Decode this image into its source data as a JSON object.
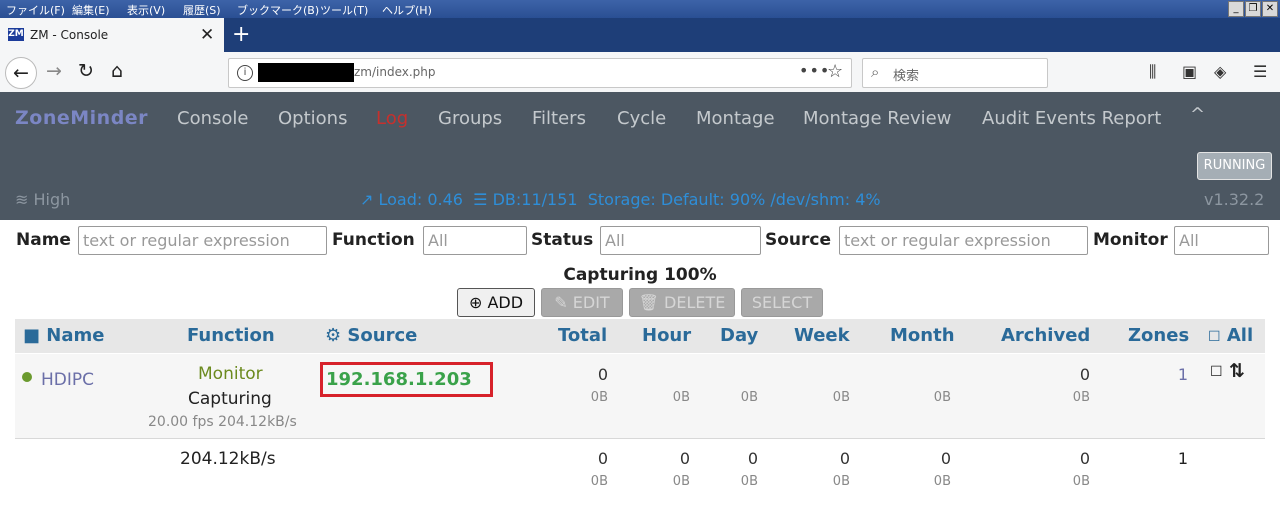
{
  "browser": {
    "menu": [
      "ファイル(F)",
      "編集(E)",
      "表示(V)",
      "履歴(S)",
      "ブックマーク(B)",
      "ツール(T)",
      "ヘルプ(H)"
    ],
    "tab_title": "ZM - Console",
    "favicon_text": "ZM",
    "url_path": "zm/index.php",
    "search_placeholder": "検索"
  },
  "zm": {
    "brand": "ZoneMinder",
    "nav": [
      "Console",
      "Options",
      "Log",
      "Groups",
      "Filters",
      "Cycle",
      "Montage",
      "Montage Review",
      "Audit Events Report"
    ],
    "active_nav": "Log",
    "running": "RUNNING",
    "bandwidth": "High",
    "load": "Load: 0.46",
    "db": "DB:11/151",
    "storage": "Storage: Default: 90% /dev/shm: 4%",
    "version": "v1.32.2"
  },
  "filters": {
    "name_label": "Name",
    "name_placeholder": "text or regular expression",
    "function_label": "Function",
    "function_value": "All",
    "status_label": "Status",
    "status_value": "All",
    "source_label": "Source",
    "source_placeholder": "text or regular expression",
    "monitor_label": "Monitor",
    "monitor_value": "All"
  },
  "capturing": "Capturing 100%",
  "actions": {
    "add": "ADD",
    "edit": "EDIT",
    "delete": "DELETE",
    "select": "SELECT"
  },
  "table": {
    "headers": {
      "name": "Name",
      "function": "Function",
      "source": "Source",
      "total": "Total",
      "hour": "Hour",
      "day": "Day",
      "week": "Week",
      "month": "Month",
      "archived": "Archived",
      "zones": "Zones",
      "all": "All"
    },
    "monitor": {
      "name": "HDIPC",
      "function": "Monitor",
      "status": "Capturing",
      "fps": "20.00 fps 204.12kB/s",
      "source": "192.168.1.203",
      "total": "0",
      "total_size": "0B",
      "hour_size": "0B",
      "day_size": "0B",
      "week_size": "0B",
      "month_size": "0B",
      "archived": "0",
      "archived_size": "0B",
      "zones": "1"
    },
    "totals": {
      "bandwidth": "204.12kB/s",
      "total": "0",
      "hour": "0",
      "day": "0",
      "week": "0",
      "month": "0",
      "archived": "0",
      "total_size": "0B",
      "hour_size": "0B",
      "day_size": "0B",
      "week_size": "0B",
      "month_size": "0B",
      "archived_size": "0B",
      "zones": "1"
    }
  },
  "colors": {
    "header_bg": "#4c5762",
    "brand": "#7b86c4",
    "active_nav": "#c6302d",
    "stats": "#2e8ed8",
    "online_dot": "#6b9a2e",
    "highlight_box": "#d7222b"
  }
}
